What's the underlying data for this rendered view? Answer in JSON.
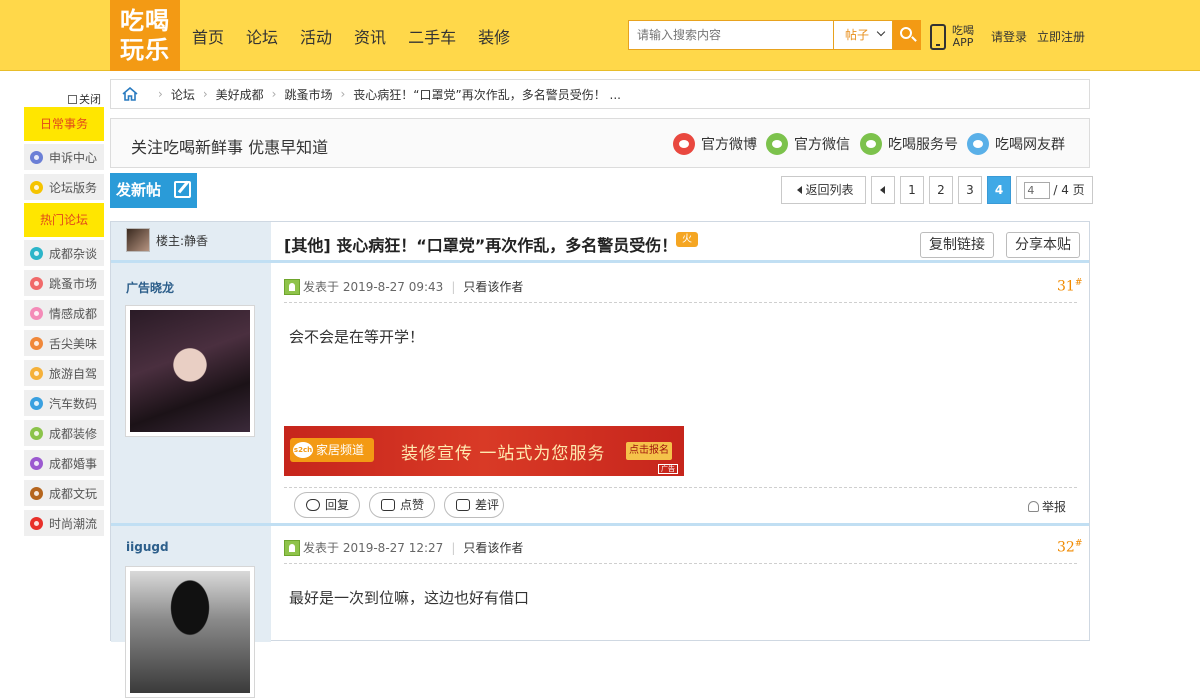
{
  "header": {
    "logo": "吃喝玩乐",
    "nav": [
      "首页",
      "论坛",
      "活动",
      "资讯",
      "二手车",
      "装修"
    ],
    "search_placeholder": "请输入搜索内容",
    "search_type": "帖子",
    "app_line1": "吃喝",
    "app_line2": "APP",
    "login": "请登录",
    "register": "立即注册",
    "colors": {
      "bar": "#ffd84a",
      "accent": "#f39a14"
    }
  },
  "sidebar": {
    "close": "关闭",
    "section1": "日常事务",
    "items1": [
      {
        "label": "申诉中心",
        "color": "#6b7fd6"
      },
      {
        "label": "论坛版务",
        "color": "#f5c400"
      }
    ],
    "section2": "热门论坛",
    "items2": [
      {
        "label": "成都杂谈",
        "color": "#2cb5c9"
      },
      {
        "label": "跳蚤市场",
        "color": "#f06a6a"
      },
      {
        "label": "情感成都",
        "color": "#f48bb8"
      },
      {
        "label": "舌尖美味",
        "color": "#f0883a"
      },
      {
        "label": "旅游自驾",
        "color": "#f5b13a"
      },
      {
        "label": "汽车数码",
        "color": "#3aa0e0"
      },
      {
        "label": "成都装修",
        "color": "#8bc34a"
      },
      {
        "label": "成都婚事",
        "color": "#9b59d0"
      },
      {
        "label": "成都文玩",
        "color": "#b5651d"
      },
      {
        "label": "时尚潮流",
        "color": "#e8302a"
      }
    ]
  },
  "breadcrumb": {
    "items": [
      "论坛",
      "美好成都",
      "跳蚤市场",
      "丧心病狂！“口罩党”再次作乱，多名警员受伤！ ..."
    ]
  },
  "follow": {
    "text": "关注吃喝新鲜事 优惠早知道",
    "links": [
      {
        "label": "官方微博",
        "color": "#e9483f"
      },
      {
        "label": "官方微信",
        "color": "#7cc24c"
      },
      {
        "label": "吃喝服务号",
        "color": "#7cc24c"
      },
      {
        "label": "吃喝网友群",
        "color": "#5ab0e8"
      }
    ]
  },
  "actionbar": {
    "new_post": "发新帖",
    "back": "返回列表",
    "pages": [
      "1",
      "2",
      "3"
    ],
    "current": "4",
    "jump_value": "4",
    "total": "/ 4 页"
  },
  "thread": {
    "op_label": "楼主: ",
    "op_name": "静香",
    "category": "[其他]",
    "title": " 丧心病狂！“口罩党”再次作乱，多名警员受伤！",
    "hot": "火",
    "copy_link": "复制链接",
    "share": "分享本贴"
  },
  "posts": [
    {
      "author": "广告晓龙",
      "time": "发表于 2019-8-27 09:43",
      "only_author": "只看该作者",
      "floor": "31",
      "content": "会不会是在等开学！",
      "ad": {
        "brand": "家居频道",
        "slogan": "装修宣传 一站式为您服务",
        "cta": "点击报名",
        "tag": "广告"
      },
      "reply": "回复",
      "like": "点赞",
      "dislike": "差评",
      "report": "举报"
    },
    {
      "author": "iigugd",
      "time": "发表于 2019-8-27 12:27",
      "only_author": "只看该作者",
      "floor": "32",
      "content": "最好是一次到位嘛，这边也好有借口"
    }
  ]
}
